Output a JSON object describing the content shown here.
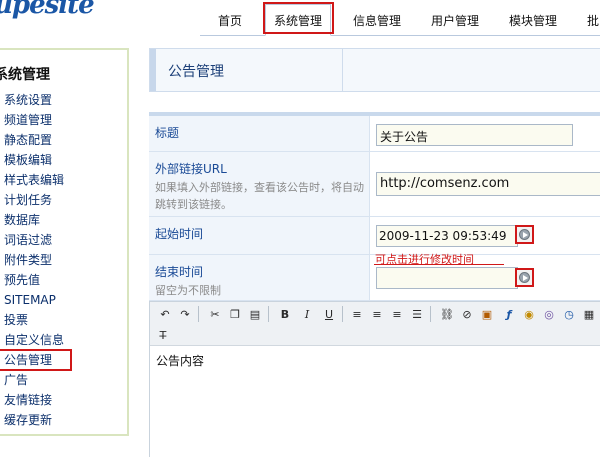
{
  "logo": "upesite",
  "nav": {
    "items": [
      "首页",
      "系统管理",
      "信息管理",
      "用户管理",
      "模块管理",
      "批"
    ],
    "active_index": 1
  },
  "sidebar": {
    "title": "系统管理",
    "items": [
      "系统设置",
      "频道管理",
      "静态配置",
      "模板编辑",
      "样式表编辑",
      "计划任务",
      "数据库",
      "词语过滤",
      "附件类型",
      "预先值",
      "SITEMAP",
      "投票",
      "自定义信息",
      "公告管理",
      "广告",
      "友情链接",
      "缓存更新"
    ],
    "current": "公告管理"
  },
  "page": {
    "title": "公告管理"
  },
  "form": {
    "title_label": "标题",
    "title_value": "关于公告",
    "link_label": "外部链接URL",
    "link_hint": "如果填入外部链接，查看该公告时，将自动跳转到该链接。",
    "link_value": "http://comsenz.com",
    "start_label": "起始时间",
    "start_value": "2009-11-23 09:53:49",
    "end_label": "结束时间",
    "end_hint": "留空为不限制",
    "end_value": "",
    "callout": "可点击进行修改时间"
  },
  "editor": {
    "toolbar_icons": [
      "undo-icon",
      "redo-icon",
      "cut-icon",
      "copy-icon",
      "paste-icon",
      "bold-icon",
      "italic-icon",
      "underline-icon",
      "align-left-icon",
      "align-center-icon",
      "align-right-icon",
      "justify-icon",
      "link-icon",
      "unlink-icon",
      "image-icon",
      "flash-icon",
      "media-icon",
      "emoticon-icon",
      "clear-format-icon"
    ],
    "content": "公告内容"
  },
  "colors": {
    "brand": "#1b57a6",
    "highlight": "#d01818",
    "sidebar_border": "#d9e5bf"
  }
}
